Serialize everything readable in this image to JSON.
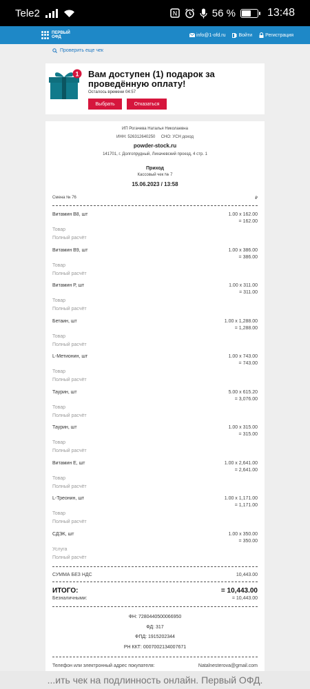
{
  "status_bar": {
    "carrier": "Tele2",
    "nfc_label": "N",
    "battery": "56 %",
    "battery_level": 0.56,
    "time": "13:48"
  },
  "header": {
    "logo_line1": "ПЕРВЫЙ",
    "logo_line2": "ОФД",
    "email": "info@1-ofd.ru",
    "login": "Войти",
    "register": "Регистрация"
  },
  "check_again": "Проверить еще чек",
  "gift": {
    "badge": "1",
    "title": "Вам доступен (1) подарок за проведённую оплату!",
    "timer": "Осталось времени 04:57",
    "choose_label": "Выбрать",
    "refuse_label": "Отказаться"
  },
  "receipt": {
    "seller": "ИП Рогачева Наталья Николаевна",
    "inn_line": "ИНН: 526312640250     СНО: УСН доход",
    "site": "powder-stock.ru",
    "address": "141701, г. Долгопрудный, Лихачевский проезд, 4 стр. 1",
    "operation": "Приход",
    "check_number": "Кассовый чек № 7",
    "datetime": "15.06.2023 / 13:58",
    "shift": "Смена № 76",
    "currency": "₽",
    "items": [
      {
        "name": "Витамин В8, шт",
        "qty": "1.00 x 162.00",
        "sum": "= 162.00",
        "type": "Товар",
        "payment": "Полный расчёт"
      },
      {
        "name": "Витамин В9, шт",
        "qty": "1.00 x 386.00",
        "sum": "= 386.00",
        "type": "Товар",
        "payment": "Полный расчёт"
      },
      {
        "name": "Витамин Р, шт",
        "qty": "1.00 x 311.00",
        "sum": "= 311.00",
        "type": "Товар",
        "payment": "Полный расчёт"
      },
      {
        "name": "Бетаин, шт",
        "qty": "1.00 x 1,288.00",
        "sum": "= 1,288.00",
        "type": "Товар",
        "payment": "Полный расчёт"
      },
      {
        "name": "L-Метионин, шт",
        "qty": "1.00 x 743.00",
        "sum": "= 743.00",
        "type": "Товар",
        "payment": "Полный расчёт"
      },
      {
        "name": "Таурин, шт",
        "qty": "5.00 x 615.20",
        "sum": "= 3,076.00",
        "type": "Товар",
        "payment": "Полный расчёт"
      },
      {
        "name": "Таурин, шт",
        "qty": "1.00 x 315.00",
        "sum": "= 315.00",
        "type": "Товар",
        "payment": "Полный расчёт"
      },
      {
        "name": "Витамин Е, шт",
        "qty": "1.00 x 2,641.00",
        "sum": "= 2,641.00",
        "type": "Товар",
        "payment": "Полный расчёт"
      },
      {
        "name": "L-Треонин, шт",
        "qty": "1.00 x 1,171.00",
        "sum": "= 1,171.00",
        "type": "Товар",
        "payment": "Полный расчёт"
      },
      {
        "name": "СДЭК, шт",
        "qty": "1.00 x 350.00",
        "sum": "= 350.00",
        "type": "Услуга",
        "payment": "Полный расчёт"
      }
    ],
    "sum_no_vat_label": "СУММА БЕЗ НДС",
    "sum_no_vat_value": "10,443.00",
    "total_label": "ИТОГО:",
    "total_value": "= 10,443.00",
    "cashless_label": "Безналичными:",
    "cashless_value": "= 10,443.00",
    "fn": "ФН: 7280440500066950",
    "fd": "ФД: 317",
    "fpd": "ФПД: 1915202344",
    "rn_kkt": "РН ККТ: 0007002134007671",
    "buyer_label": "Телефон или электронный адрес покупателя:",
    "buyer_value": "Natalnesterova@gmail.com"
  },
  "bottom_banner": "...ить чек на подлинность онлайн. Первый ОФД."
}
